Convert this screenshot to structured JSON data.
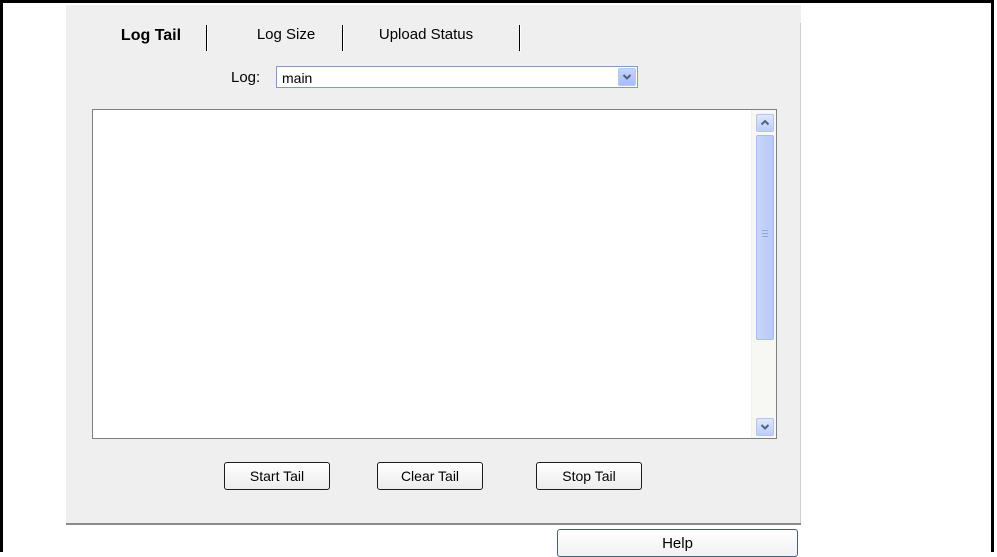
{
  "tabs": [
    {
      "label": "Log Tail",
      "active": true
    },
    {
      "label": "Log Size",
      "active": false
    },
    {
      "label": "Upload Status",
      "active": false
    }
  ],
  "log": {
    "label": "Log:",
    "selected": "main"
  },
  "buttons": {
    "start": "Start Tail",
    "clear": "Clear Tail",
    "stop": "Stop Tail",
    "help": "Help"
  },
  "icons": {
    "dropdown": "chevron-down-icon",
    "scroll_up": "chevron-up-icon",
    "scroll_down": "chevron-down-icon"
  },
  "colors": {
    "panel_bg": "#efefef",
    "scroll_accent": "#c9d6fb",
    "arrow": "#4d6185"
  }
}
